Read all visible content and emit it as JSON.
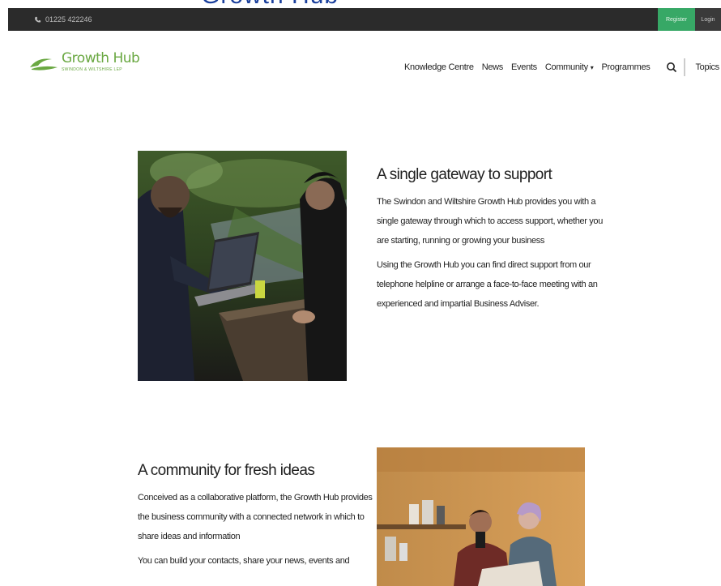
{
  "topbar": {
    "phone": "01225 422246",
    "register_label": "Register",
    "login_label": "Login"
  },
  "page_title_fragment": "Growth Hub",
  "logo": {
    "name": "Growth Hub",
    "subtitle": "SWINDON & WILTSHIRE LEP"
  },
  "nav": {
    "items": [
      "Knowledge Centre",
      "News",
      "Events",
      "Community",
      "Programmes"
    ],
    "topics_label": "Topics"
  },
  "sections": [
    {
      "heading": "A single gateway to support",
      "paragraphs": [
        "The Swindon and Wiltshire Growth Hub provides you with a single gateway through which to access support, whether you are starting, running or growing your business",
        "Using the Growth Hub you can find direct support from our telephone helpline or arrange a face-to-face meeting with an experienced and impartial Business Adviser."
      ]
    },
    {
      "heading": "A community for fresh ideas",
      "paragraphs": [
        "Conceived as a collaborative platform, the Growth Hub provides the business community with a connected network in which to share ideas and information",
        "You can build your contacts, share your news, events and"
      ]
    }
  ],
  "icons": {
    "phone": "phone-icon",
    "search": "search-icon",
    "menu": "hamburger-menu-icon",
    "caret": "chevron-down-icon"
  },
  "colors": {
    "topbar_bg": "#2b2b2b",
    "register_bg": "#37a866",
    "brand_green": "#6aa842",
    "title_blue": "#1a3f9c"
  }
}
